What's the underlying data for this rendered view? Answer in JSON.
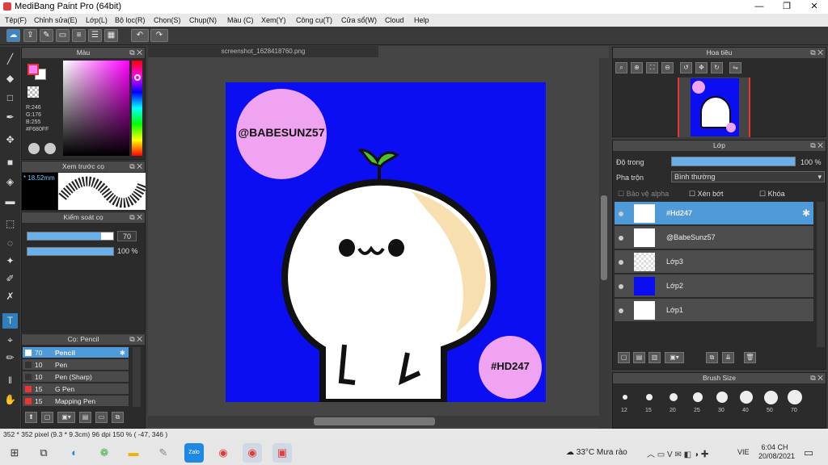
{
  "titlebar": {
    "title": "MediBang Paint Pro (64bit)",
    "minimize": "—",
    "maximize": "❐",
    "close": "✕"
  },
  "menu": [
    "Tệp(F)",
    "Chỉnh sửa(E)",
    "Lớp(L)",
    "Bộ lọc(R)",
    "Chọn(S)",
    "Chụp(N)",
    "Màu (C)",
    "Xem(Y)",
    "Công cụ(T)",
    "Cửa sổ(W)",
    "Cloud",
    "Help"
  ],
  "toolbar": {
    "icons": [
      "cloud-icon",
      "share-icon",
      "comment-icon",
      "page-icon",
      "document-icon",
      "list-icon",
      "grid-icon"
    ],
    "undo": "↶",
    "redo": "↷"
  },
  "color_panel": {
    "title": "Màu",
    "r": "R:246",
    "g": "G:176",
    "b": "B:255",
    "hex": "#F680FF",
    "fg": "#F680FF",
    "bg": "#ffffff"
  },
  "preview_panel": {
    "title": "Xem trước cọ",
    "size": "18.52mm"
  },
  "brush_control": {
    "title": "Kiểm soát cọ",
    "size_value": "70",
    "opacity_value": "100 %",
    "size_pct": 0.86,
    "opacity_pct": 1.0
  },
  "brush_list": {
    "title": "Cọ: Pencil",
    "items": [
      {
        "size": "70",
        "name": "Pencil",
        "color": "#ffffff",
        "active": true
      },
      {
        "size": "10",
        "name": "Pen",
        "color": "#333333",
        "active": false
      },
      {
        "size": "10",
        "name": "Pen (Sharp)",
        "color": "#333333",
        "active": false
      },
      {
        "size": "15",
        "name": "G Pen",
        "color": "#e33",
        "active": false
      },
      {
        "size": "15",
        "name": "Mapping Pen",
        "color": "#e33",
        "active": false
      }
    ]
  },
  "canvas": {
    "tab": "screenshot_1628418760.png",
    "label_top": "@BABESUNZ57",
    "label_bottom": "#HD247",
    "face": "●ω●"
  },
  "navigator": {
    "title": "Hoa tiêu"
  },
  "layers": {
    "title": "Lớp",
    "opacity_label": "Độ trong",
    "opacity_value": "100 %",
    "opacity_pct": 1.0,
    "blend_label": "Pha trộn",
    "blend_value": "Bình thường",
    "protect_alpha": "Bảo vệ alpha",
    "clipping": "Xén bớt",
    "lock": "Khóa",
    "items": [
      {
        "name": "#Hd247",
        "active": true
      },
      {
        "name": "@BabeSunz57",
        "active": false
      },
      {
        "name": "Lớp3",
        "active": false
      },
      {
        "name": "Lớp2",
        "active": false
      },
      {
        "name": "Lớp1",
        "active": false
      }
    ]
  },
  "brush_size": {
    "title": "Brush Size",
    "sizes": [
      "12",
      "15",
      "20",
      "25",
      "30",
      "40",
      "50",
      "70"
    ]
  },
  "status": {
    "text": "352 * 352 pixel  (9.3 * 9.3cm)  96 dpi  150 %  ( -47, 346 )"
  },
  "taskbar": {
    "weather": "33°C  Mưa rào",
    "lang": "VIE",
    "time": "6:04 CH",
    "date": "20/08/2021"
  }
}
